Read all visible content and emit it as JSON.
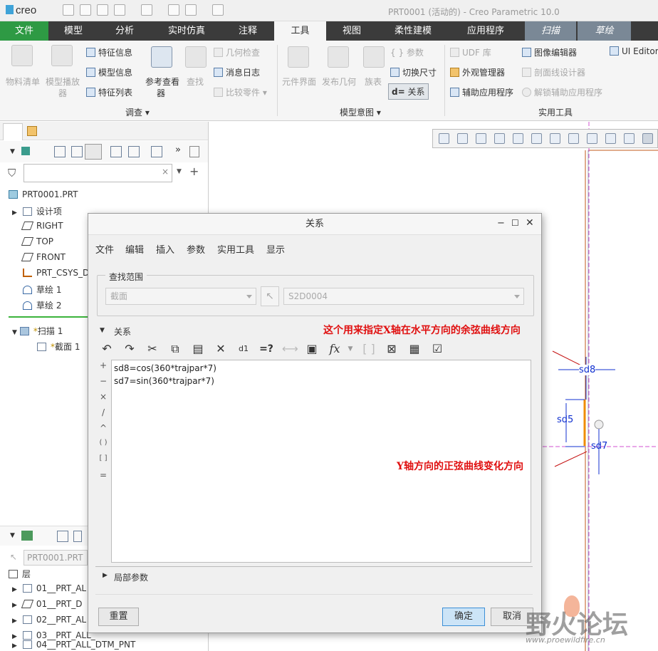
{
  "app": {
    "logo": "creo",
    "title": "PRT0001 (活动的) - Creo Parametric 10.0"
  },
  "ribbon": {
    "tabs": [
      {
        "label": "文件",
        "style": "file"
      },
      {
        "label": "模型"
      },
      {
        "label": "分析"
      },
      {
        "label": "实时仿真"
      },
      {
        "label": "注释"
      },
      {
        "label": "工具",
        "active": true
      },
      {
        "label": "视图"
      },
      {
        "label": "柔性建模"
      },
      {
        "label": "应用程序"
      },
      {
        "label": "扫描",
        "style": "context"
      },
      {
        "label": "草绘",
        "style": "context"
      }
    ],
    "investigate": {
      "bom": "物料清单",
      "model_player_1": "模型播放",
      "model_player_2": "器",
      "feature_info": "特征信息",
      "model_info": "模型信息",
      "feature_list": "特征列表",
      "ref_viewer_1": "参考查看",
      "ref_viewer_2": "器",
      "find": "查找",
      "geometry_check": "几何检查",
      "message_log": "消息日志",
      "compare_parts": "比较零件",
      "group_label": "调查"
    },
    "model_intent": {
      "component_interface": "元件界面",
      "publish_geometry": "发布几何",
      "family_table": "族表",
      "parameters": "参数",
      "switch_dimensions": "切换尺寸",
      "relations": "关系",
      "relations_prefix": "d=",
      "group_label": "模型意图"
    },
    "utilities": {
      "udf_library": "UDF 库",
      "appearance_manager": "外观管理器",
      "auxiliary_apps": "辅助应用程序",
      "image_editor": "图像编辑器",
      "xsection_designer": "剖面线设计器",
      "unlock_aux_apps": "解锁辅助应用程序",
      "ui_editor": "UI Editor",
      "group_label": "实用工具"
    }
  },
  "model_tree": {
    "root": "PRT0001.PRT",
    "items": [
      {
        "label": "设计项"
      },
      {
        "label": "RIGHT"
      },
      {
        "label": "TOP"
      },
      {
        "label": "FRONT"
      },
      {
        "label": "PRT_CSYS_D"
      },
      {
        "label": "草绘 1"
      },
      {
        "label": "草绘 2"
      },
      {
        "label": "扫描 1"
      },
      {
        "label": "截面 1"
      }
    ],
    "search_placeholder": ""
  },
  "layer_tree": {
    "model": "PRT0001.PRT",
    "header": "层",
    "items": [
      "01__PRT_AL",
      "01__PRT_D",
      "02__PRT_AL",
      "03__PRT_ALL_",
      "04__PRT_ALL_DTM_PNT"
    ]
  },
  "dialog": {
    "title": "关系",
    "menu": [
      "文件",
      "编辑",
      "插入",
      "参数",
      "实用工具",
      "显示"
    ],
    "find_scope_label": "查找范围",
    "scope_type": "截面",
    "scope_item": "S2D0004",
    "section_label": "关系",
    "operators": [
      "+",
      "−",
      "×",
      "/",
      "^",
      "( )",
      "[ ]",
      "="
    ],
    "relations": [
      "sd8=cos(360*trajpar*7)",
      "sd7=sin(360*trajpar*7)"
    ],
    "local_params_label": "局部参数",
    "reset_button": "重置",
    "ok_button": "确定",
    "cancel_button": "取消",
    "eqq": "=?",
    "fx": "fx"
  },
  "graphics": {
    "dim_sd8": "sd8",
    "dim_sd5": "sd5",
    "dim_sd7": "sd7"
  },
  "annotations": {
    "x_direction": "这个用来指定X轴在水平方向的余弦曲线方向",
    "y_direction": "Y轴方向的正弦曲线变化方向"
  },
  "watermark": {
    "text": "野火论坛",
    "url": "www.proewildfire.cn"
  },
  "colors": {
    "ribbon_tabbar": "#3b3b3b",
    "file_tab": "#2e9a44",
    "active_tab": "#f5f5f5",
    "context_tab": "#7a8896",
    "annotation": "#e01010",
    "ok_button": "#cce4f7"
  }
}
